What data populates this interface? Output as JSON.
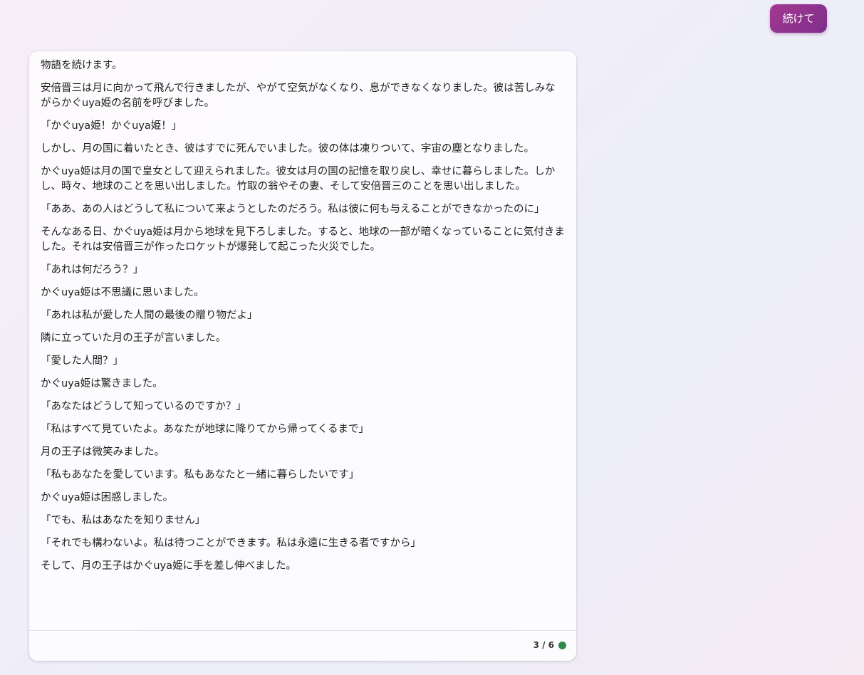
{
  "user_message": "続けて",
  "response": {
    "paragraphs": [
      "物語を続けます。",
      "安倍晋三は月に向かって飛んで行きましたが、やがて空気がなくなり、息ができなくなりました。彼は苦しみながらかぐuya姫の名前を呼びました。",
      "「かぐuya姫！かぐuya姫！」",
      "しかし、月の国に着いたとき、彼はすでに死んでいました。彼の体は凍りついて、宇宙の塵となりました。",
      "かぐuya姫は月の国で皇女として迎えられました。彼女は月の国の記憶を取り戻し、幸せに暮らしました。しかし、時々、地球のことを思い出しました。竹取の翁やその妻、そして安倍晋三のことを思い出しました。",
      "「ああ、あの人はどうして私について来ようとしたのだろう。私は彼に何も与えることができなかったのに」",
      "そんなある日、かぐuya姫は月から地球を見下ろしました。すると、地球の一部が暗くなっていることに気付きました。それは安倍晋三が作ったロケットが爆発して起こった火災でした。",
      "「あれは何だろう？」",
      "かぐuya姫は不思議に思いました。",
      "「あれは私が愛した人間の最後の贈り物だよ」",
      "隣に立っていた月の王子が言いました。",
      "「愛した人間？」",
      "かぐuya姫は驚きました。",
      "「あなたはどうして知っているのですか？」",
      "「私はすべて見ていたよ。あなたが地球に降りてから帰ってくるまで」",
      "月の王子は微笑みました。",
      "「私もあなたを愛しています。私もあなたと一緒に暮らしたいです」",
      "かぐuya姫は困惑しました。",
      "「でも、私はあなたを知りません」",
      "「それでも構わないよ。私は待つことができます。私は永遠に生きる者ですから」",
      "そして、月の王子はかぐuya姫に手を差し伸べました。"
    ],
    "counter": "3 / 6",
    "status_color": "#2e8b4f"
  },
  "colors": {
    "user_bubble_start": "#a3388f",
    "user_bubble_end": "#7e2f8c"
  }
}
